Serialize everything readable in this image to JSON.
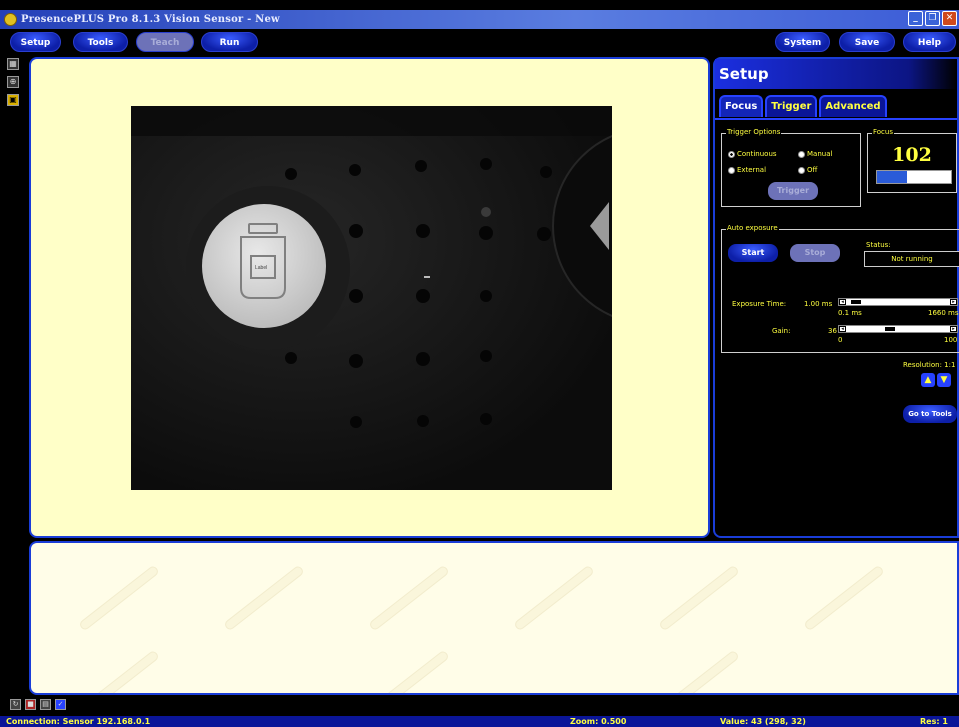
{
  "window": {
    "title": "PresencePLUS Pro 8.1.3 Vision Sensor - New",
    "buttons": [
      "_",
      "❐",
      "✕"
    ]
  },
  "toolbar": {
    "left": [
      "Setup",
      "Tools",
      "Teach",
      "Run"
    ],
    "right": [
      "System",
      "Save",
      "Help"
    ]
  },
  "camera": {
    "label_text": "Label"
  },
  "setup": {
    "title": "Setup",
    "tabs": [
      "Focus",
      "Trigger",
      "Advanced"
    ],
    "trigger_options": {
      "label": "Trigger Options",
      "options": [
        {
          "label": "Continuous",
          "selected": true
        },
        {
          "label": "Manual",
          "selected": false
        },
        {
          "label": "External",
          "selected": false
        },
        {
          "label": "Off",
          "selected": false
        }
      ],
      "trigger_button": "Trigger"
    },
    "focus": {
      "label": "Focus",
      "value": "102",
      "bar_level_percent": 40
    },
    "auto_exposure": {
      "label": "Auto exposure",
      "start_button": "Start",
      "stop_button": "Stop",
      "status_label": "Status:",
      "status_value": "Not running",
      "exposure_label": "Exposure Time:",
      "exposure_value": "1.00 ms",
      "exposure_min": "0.1 ms",
      "exposure_max": "1660 ms",
      "gain_label": "Gain:",
      "gain_value": "36",
      "gain_min": "0",
      "gain_max": "100"
    },
    "resolution": "Resolution: 1:1",
    "go_to_tools": "Go to Tools"
  },
  "statusbar": {
    "connection": "Connection: Sensor 192.168.0.1",
    "zoom": "Zoom: 0.500",
    "value": "Value: 43  (298, 32)",
    "res": "Res: 1"
  }
}
